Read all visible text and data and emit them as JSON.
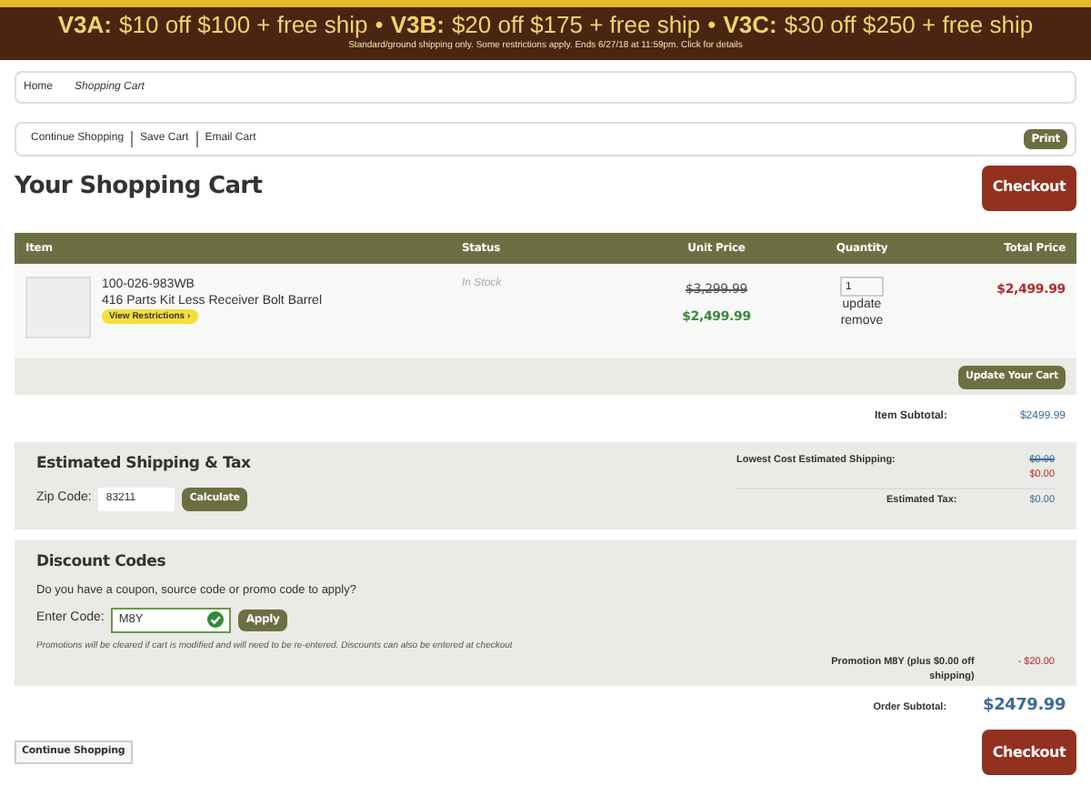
{
  "banner": {
    "offers": [
      {
        "code": "V3A:",
        "text": "$10 off $100 + free ship"
      },
      {
        "code": "V3B:",
        "text": "$20 off $175 + free ship"
      },
      {
        "code": "V3C:",
        "text": "$30 off $250 + free ship"
      }
    ],
    "separator": "•",
    "note": "Standard/ground shipping only. Some restrictions apply. Ends 6/27/18 at 11:59pm. Click for details"
  },
  "breadcrumb": [
    "Home",
    "Shopping Cart"
  ],
  "actions": [
    "Continue Shopping",
    "Save Cart",
    "Email Cart"
  ],
  "print_button": "Print",
  "title": "Your Shopping Cart",
  "checkout_button": "Checkout",
  "table": {
    "columns": [
      "Item",
      "Status",
      "Unit Price",
      "Quantity",
      "Total Price"
    ],
    "rows": [
      {
        "sku": "100-026-983WB",
        "name": "416 Parts Kit Less Receiver Bolt Barrel",
        "restrictions": "View Restrictions ›",
        "status": "In Stock",
        "old_price": "$3,299.99",
        "price": "$2,499.99",
        "quantity": "1",
        "update": "update",
        "remove": "remove",
        "total": "$2,499.99"
      }
    ]
  },
  "update_button": "Update Your Cart",
  "item_subtotal": {
    "label": "Item Subtotal:",
    "value": "$2499.99"
  },
  "shipping": {
    "heading": "Estimated Shipping & Tax",
    "zip_label": "Zip Code:",
    "zip_value": "83211",
    "calculate_button": "Calculate",
    "lowest_label": "Lowest Cost Estimated Shipping:",
    "lowest_old": "$0.00",
    "lowest_value": "$0.00",
    "tax_label": "Estimated Tax:",
    "tax_value": "$0.00"
  },
  "discount": {
    "heading": "Discount Codes",
    "question": "Do you have a coupon, source code or promo code to apply?",
    "code_label": "Enter Code:",
    "code_value": "M8Y",
    "valid": true,
    "apply_button": "Apply",
    "note": "Promotions will be cleared if cart is modified and will need to be re-entered. Discounts can also be entered at checkout",
    "promo_label": "Promotion M8Y (plus $0.00 off shipping)",
    "promo_value": "- $20.00"
  },
  "order_subtotal": {
    "label": "Order Subtotal:",
    "value": "$2479.99"
  },
  "bottom_continue": "Continue Shopping",
  "bottom_checkout": "Checkout"
}
